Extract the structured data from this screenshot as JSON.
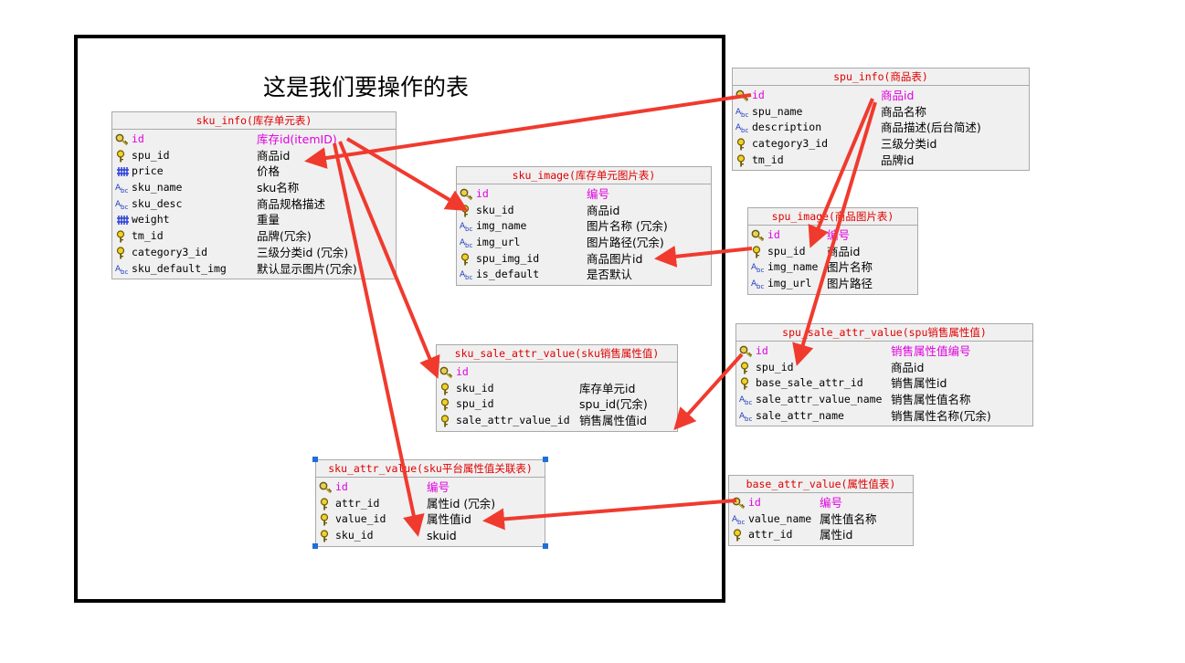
{
  "heading": "这是我们要操作的表",
  "tables": {
    "sku_info": {
      "title": "sku_info(库存单元表)",
      "rows": [
        {
          "icon": "primary-key-icon",
          "name": "id",
          "comment": "库存id(itemID)",
          "pk": true
        },
        {
          "icon": "foreign-key-icon",
          "name": "spu_id",
          "comment": "商品id"
        },
        {
          "icon": "numeric-icon",
          "name": "price",
          "comment": "价格"
        },
        {
          "icon": "text-type-icon",
          "name": "sku_name",
          "comment": "sku名称"
        },
        {
          "icon": "text-type-icon",
          "name": "sku_desc",
          "comment": "商品规格描述"
        },
        {
          "icon": "numeric-icon",
          "name": "weight",
          "comment": "重量"
        },
        {
          "icon": "foreign-key-icon",
          "name": "tm_id",
          "comment": "品牌(冗余)"
        },
        {
          "icon": "foreign-key-icon",
          "name": "category3_id",
          "comment": "三级分类id (冗余)"
        },
        {
          "icon": "text-type-icon",
          "name": "sku_default_img",
          "comment": "默认显示图片(冗余)"
        }
      ]
    },
    "sku_image": {
      "title": "sku_image(库存单元图片表)",
      "rows": [
        {
          "icon": "primary-key-icon",
          "name": "id",
          "comment": "编号",
          "pk": true
        },
        {
          "icon": "foreign-key-icon",
          "name": "sku_id",
          "comment": "商品id"
        },
        {
          "icon": "text-type-icon",
          "name": "img_name",
          "comment": "图片名称 (冗余)"
        },
        {
          "icon": "text-type-icon",
          "name": "img_url",
          "comment": "图片路径(冗余)"
        },
        {
          "icon": "foreign-key-icon",
          "name": "spu_img_id",
          "comment": "商品图片id"
        },
        {
          "icon": "text-type-icon",
          "name": "is_default",
          "comment": "是否默认"
        }
      ]
    },
    "sku_sale_attr_value": {
      "title": "sku_sale_attr_value(sku销售属性值)",
      "rows": [
        {
          "icon": "primary-key-icon",
          "name": "id",
          "comment": "",
          "pk": true
        },
        {
          "icon": "foreign-key-icon",
          "name": "sku_id",
          "comment": "库存单元id"
        },
        {
          "icon": "foreign-key-icon",
          "name": "spu_id",
          "comment": "spu_id(冗余)"
        },
        {
          "icon": "foreign-key-icon",
          "name": "sale_attr_value_id",
          "comment": "销售属性值id"
        }
      ]
    },
    "sku_attr_value": {
      "title": "sku_attr_value(sku平台属性值关联表)",
      "rows": [
        {
          "icon": "primary-key-icon",
          "name": "id",
          "comment": "编号",
          "pk": true
        },
        {
          "icon": "foreign-key-icon",
          "name": "attr_id",
          "comment": "属性id (冗余)"
        },
        {
          "icon": "foreign-key-icon",
          "name": "value_id",
          "comment": "属性值id"
        },
        {
          "icon": "foreign-key-icon",
          "name": "sku_id",
          "comment": "skuid"
        }
      ]
    },
    "spu_info": {
      "title": "spu_info(商品表)",
      "rows": [
        {
          "icon": "primary-key-icon",
          "name": "id",
          "comment": "商品id",
          "pk": true
        },
        {
          "icon": "text-type-icon",
          "name": "spu_name",
          "comment": "商品名称"
        },
        {
          "icon": "text-type-icon",
          "name": "description",
          "comment": "商品描述(后台简述)"
        },
        {
          "icon": "foreign-key-icon",
          "name": "category3_id",
          "comment": "三级分类id"
        },
        {
          "icon": "foreign-key-icon",
          "name": "tm_id",
          "comment": "品牌id"
        }
      ]
    },
    "spu_image": {
      "title": "spu_image(商品图片表)",
      "rows": [
        {
          "icon": "primary-key-icon",
          "name": "id",
          "comment": "编号",
          "pk": true
        },
        {
          "icon": "foreign-key-icon",
          "name": "spu_id",
          "comment": "商品id"
        },
        {
          "icon": "text-type-icon",
          "name": "img_name",
          "comment": "图片名称"
        },
        {
          "icon": "text-type-icon",
          "name": "img_url",
          "comment": "图片路径"
        }
      ]
    },
    "spu_sale_attr_value": {
      "title": "spu_sale_attr_value(spu销售属性值)",
      "rows": [
        {
          "icon": "primary-key-icon",
          "name": "id",
          "comment": "销售属性值编号",
          "pk": true
        },
        {
          "icon": "foreign-key-icon",
          "name": "spu_id",
          "comment": "商品id"
        },
        {
          "icon": "foreign-key-icon",
          "name": "base_sale_attr_id",
          "comment": "销售属性id"
        },
        {
          "icon": "text-type-icon",
          "name": "sale_attr_value_name",
          "comment": "销售属性值名称"
        },
        {
          "icon": "text-type-icon",
          "name": "sale_attr_name",
          "comment": "销售属性名称(冗余)"
        }
      ]
    },
    "base_attr_value": {
      "title": "base_attr_value(属性值表)",
      "rows": [
        {
          "icon": "primary-key-icon",
          "name": "id",
          "comment": "编号",
          "pk": true
        },
        {
          "icon": "text-type-icon",
          "name": "value_name",
          "comment": "属性值名称"
        },
        {
          "icon": "foreign-key-icon",
          "name": "attr_id",
          "comment": "属性id"
        }
      ]
    }
  },
  "colors": {
    "arrow": "#f03a2e",
    "title_text": "#e00000",
    "primary_key_text": "#e000e0",
    "table_bg": "#f0f0f0",
    "frame": "#000000",
    "selection_handle": "#1e6fd9"
  }
}
